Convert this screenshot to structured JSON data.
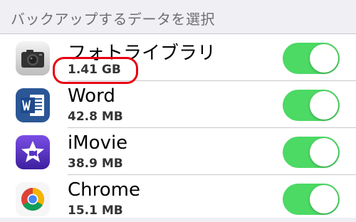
{
  "header": {
    "title": "バックアップするデータを選択"
  },
  "apps": [
    {
      "name": "フォトライブラリ",
      "size": "1.41 GB",
      "icon": "camera-icon",
      "enabled": true
    },
    {
      "name": "Word",
      "size": "42.8 MB",
      "icon": "word-icon",
      "enabled": true
    },
    {
      "name": "iMovie",
      "size": "38.9 MB",
      "icon": "imovie-icon",
      "enabled": true
    },
    {
      "name": "Chrome",
      "size": "15.1 MB",
      "icon": "chrome-icon",
      "enabled": true
    }
  ],
  "colors": {
    "toggle_on": "#4cd964",
    "highlight": "#e60012",
    "header_bg": "#efeff4"
  }
}
